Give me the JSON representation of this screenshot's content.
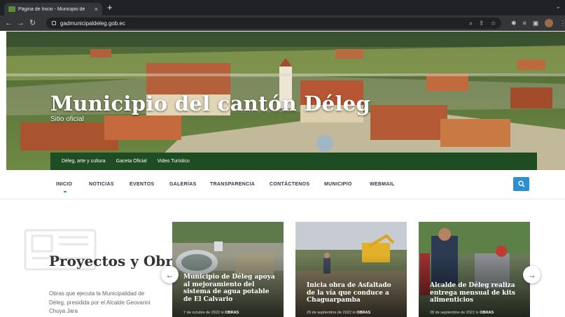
{
  "browser": {
    "tab_title": "Página de Inicio - Municipio de",
    "tab_close": "×",
    "new_tab": "+",
    "url": "gadmunicipaldeleg.gob.ec"
  },
  "hero": {
    "title": "Municipio del cantón Déleg",
    "subtitle": "Sitio oficial",
    "links": [
      "Déleg, arte y cultura",
      "Gaceta Oficial",
      "Video Turístico"
    ]
  },
  "nav": {
    "items": [
      "INICIO",
      "NOTICIAS",
      "EVENTOS",
      "GALERÍAS",
      "TRANSPARENCIA",
      "CONTÁCTENOS",
      "MUNICIPIO",
      "WEBMAIL"
    ],
    "active": "INICIO",
    "accent": "#2c8fd3"
  },
  "projects": {
    "title": "Proyectos y Obras",
    "description": "Obras que ejecuta la Municipalidad de Déleg, presidida por el Alcalde Geovanni Chuya Jara"
  },
  "cards": [
    {
      "title": "Municipio de Déleg apoya al mejoramiento del sistema de agua potable de El Calvario",
      "date": "7 de octubre de 2022",
      "in": "in",
      "category": "OBRAS"
    },
    {
      "title": "Inicia obra de Asfaltado de la vía que conduce a Chaguarpamba",
      "date": "29 de septiembre de 2022",
      "in": "in",
      "category": "OBRAS"
    },
    {
      "title": "Alcalde de Déleg realiza entrega mensual de kits alimenticios",
      "date": "28 de septiembre de 2022",
      "in": "in",
      "category": "OBRAS"
    }
  ],
  "carousel": {
    "prev": "←",
    "next": "→"
  }
}
